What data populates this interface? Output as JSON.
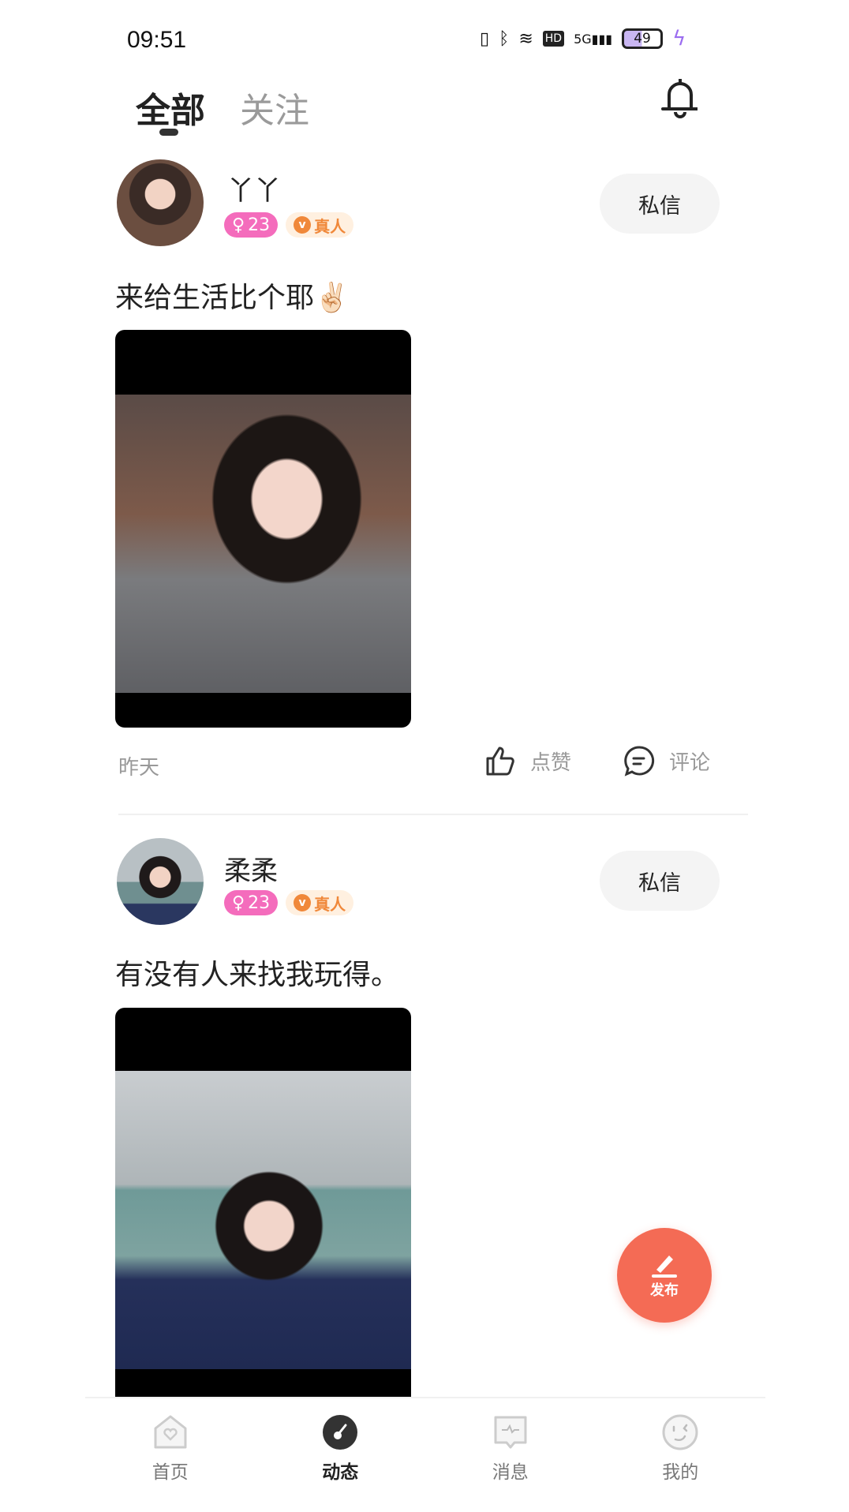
{
  "status_bar": {
    "time": "09:51",
    "battery": "49",
    "icons": [
      "vibrate-icon",
      "bluetooth-icon",
      "wifi-icon",
      "hd-icon",
      "5g-signal-icon",
      "battery-icon",
      "charging-icon"
    ]
  },
  "header": {
    "tabs": [
      {
        "label": "全部",
        "active": true
      },
      {
        "label": "关注",
        "active": false
      }
    ],
    "notification_icon": "bell-icon"
  },
  "posts": [
    {
      "username": "丫丫",
      "age": "23",
      "gender": "female",
      "verified_label": "真人",
      "dm_label": "私信",
      "text": "来给生活比个耶✌🏻",
      "time": "昨天",
      "like_label": "点赞",
      "comment_label": "评论"
    },
    {
      "username": "柔柔",
      "age": "23",
      "gender": "female",
      "verified_label": "真人",
      "dm_label": "私信",
      "text": "有没有人来找我玩得。"
    }
  ],
  "fab": {
    "label": "发布",
    "color": "#f46b55"
  },
  "bottom_nav": [
    {
      "label": "首页",
      "icon": "home-heart-icon"
    },
    {
      "label": "动态",
      "icon": "feed-icon",
      "active": true
    },
    {
      "label": "消息",
      "icon": "message-icon"
    },
    {
      "label": "我的",
      "icon": "profile-face-icon"
    }
  ],
  "colors": {
    "age_badge": "#f46cbc",
    "verified_badge": "#f0883a",
    "accent": "#f46b55"
  }
}
